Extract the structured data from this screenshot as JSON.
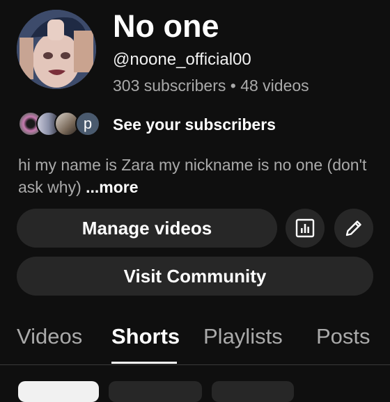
{
  "channel": {
    "name": "No one",
    "handle": "@noone_official00",
    "stats": "303 subscribers • 48 videos"
  },
  "subscribers_row": {
    "last_avatar_letter": "p",
    "link_label": "See your subscribers"
  },
  "description": {
    "text": "hi my name is Zara my nickname is no one (don't ask why) ",
    "more_label": "...more"
  },
  "actions": {
    "manage_label": "Manage videos",
    "analytics_icon": "analytics-icon",
    "edit_icon": "pencil-icon",
    "community_label": "Visit Community"
  },
  "tabs": [
    {
      "label": "Videos",
      "active": false
    },
    {
      "label": "Shorts",
      "active": true
    },
    {
      "label": "Playlists",
      "active": false
    },
    {
      "label": "Posts",
      "active": false
    }
  ],
  "colors": {
    "background": "#0f0f0f",
    "button": "#272727",
    "secondary_text": "#aaaaaa"
  }
}
